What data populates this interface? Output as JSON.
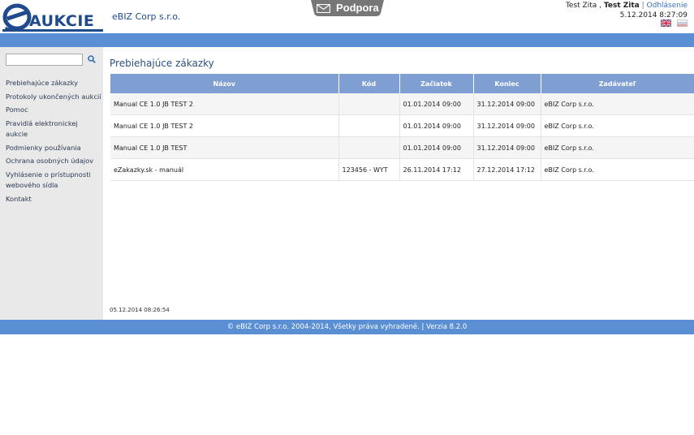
{
  "header": {
    "logo_text": "AUKCIE",
    "company_name": "eBIZ Corp s.r.o.",
    "support_label": "Podpora",
    "user_first": "Test Zita",
    "user_second": "Test Zita",
    "separator": "|",
    "logout_label": "Odhlásenie",
    "datetime": "5.12.2014 8:27:09",
    "languages": [
      "en-flag-icon",
      "sk-flag-icon"
    ]
  },
  "search": {
    "value": "",
    "placeholder": "",
    "icon": "search-icon"
  },
  "sidebar": {
    "items": [
      {
        "label": "Prebiehajúce zákazky"
      },
      {
        "label": "Protokoly ukončených aukcií"
      },
      {
        "label": "Pomoc"
      },
      {
        "label": "Pravidlá elektronickej aukcie"
      },
      {
        "label": "Podmienky používania"
      },
      {
        "label": "Ochrana osobných údajov"
      },
      {
        "label": "Vyhlásenie o prístupnosti webového sídla"
      },
      {
        "label": "Kontakt"
      }
    ]
  },
  "main": {
    "title": "Prebiehajúce zákazky",
    "columns": [
      "Názov",
      "Kód",
      "Začiatok",
      "Koniec",
      "Zadávateľ"
    ],
    "rows": [
      {
        "name": "Manual CE 1.0 JB TEST 2",
        "code": "",
        "start": "01.01.2014 09:00",
        "end": "31.12.2014 09:00",
        "client": "eBIZ Corp s.r.o."
      },
      {
        "name": "Manual CE 1.0 JB TEST 2",
        "code": "",
        "start": "01.01.2014 09:00",
        "end": "31.12.2014 09:00",
        "client": "eBIZ Corp s.r.o."
      },
      {
        "name": "Manual CE 1.0 JB TEST",
        "code": "",
        "start": "01.01.2014 09:00",
        "end": "31.12.2014 09:00",
        "client": "eBIZ Corp s.r.o."
      },
      {
        "name": "eZakazky.sk - manuál",
        "code": "123456 - WYT",
        "start": "26.11.2014 17:12",
        "end": "27.12.2014 17:12",
        "client": "eBIZ Corp s.r.o."
      }
    ],
    "timestamp": "05.12.2014 08:26:54"
  },
  "footer": {
    "text": "© eBIZ Corp s.r.o. 2004-2014, Všetky práva vyhradené. | Verzia 8.2.0"
  },
  "colors": {
    "bar_blue": "#5b8fd4",
    "header_blue": "#7f9fd2",
    "brand_blue": "#1f4a8c",
    "sidebar_bg": "#e9e9e9"
  }
}
